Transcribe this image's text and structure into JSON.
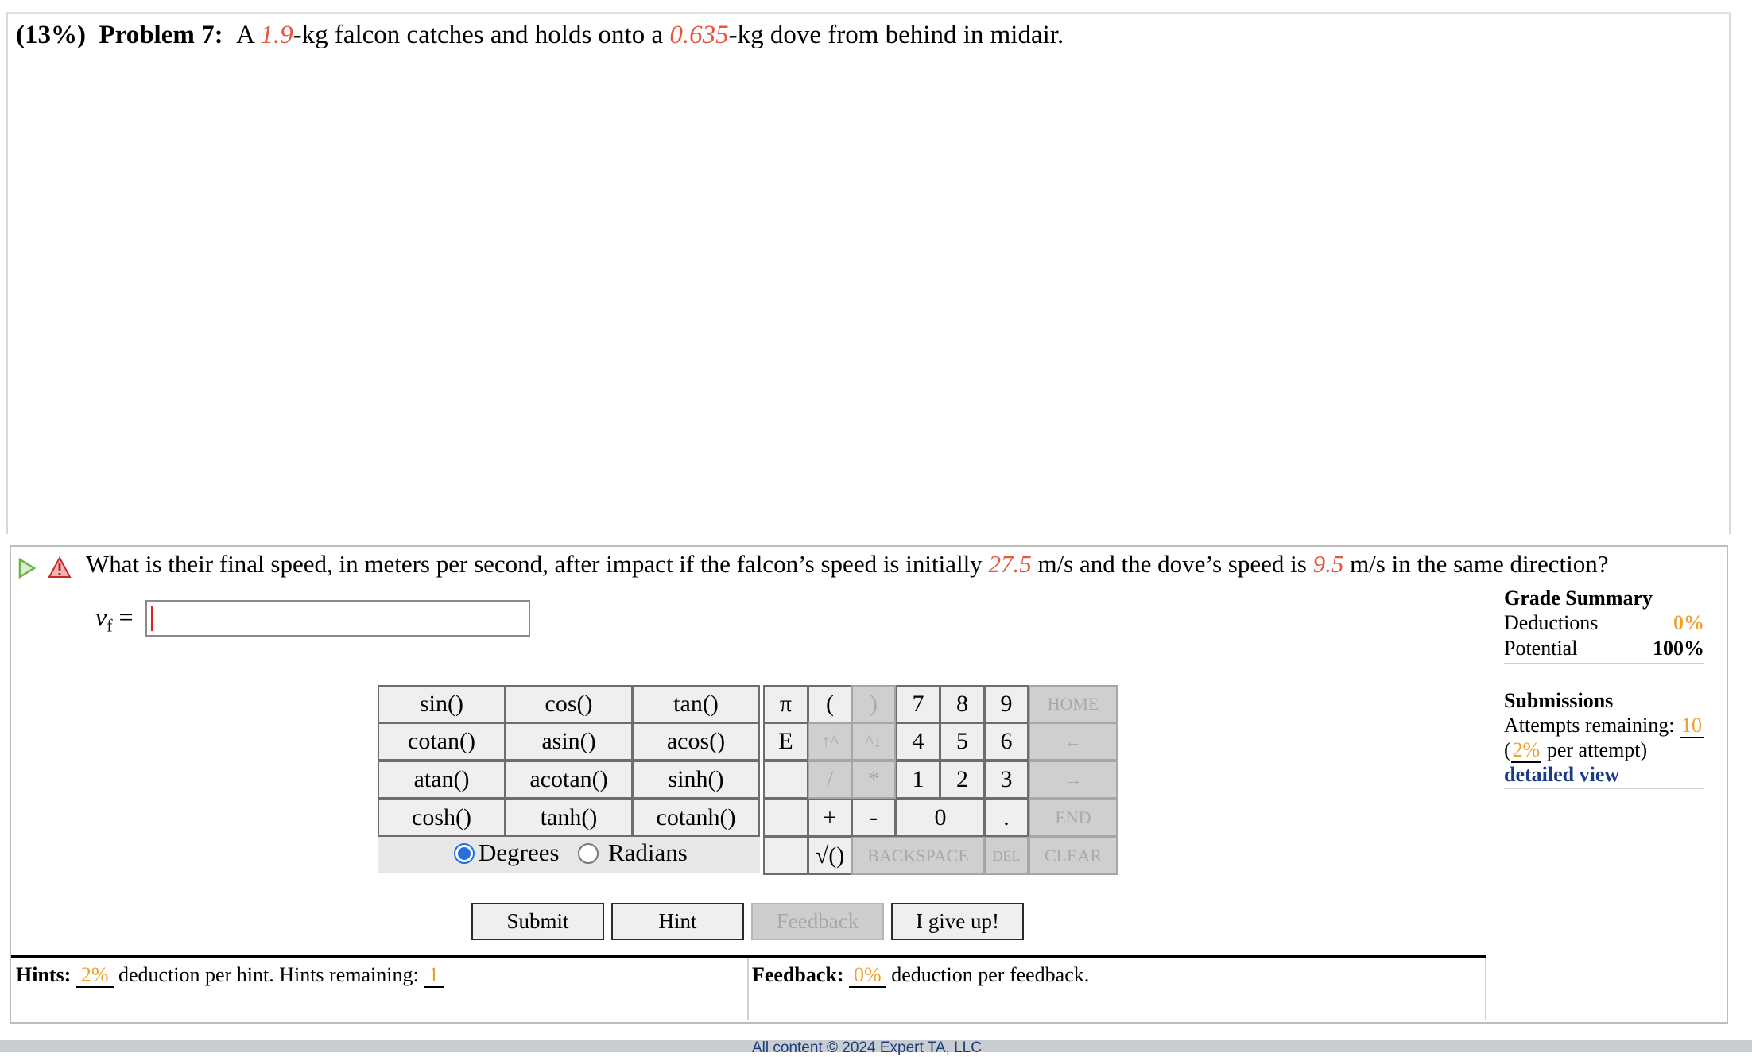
{
  "problem": {
    "weight": "(13%)",
    "label": "Problem 7:",
    "text_a": "A ",
    "mass_falcon": "1.9",
    "text_b": "-kg falcon catches and holds onto a ",
    "mass_dove": "0.635",
    "text_c": "-kg dove from behind in midair."
  },
  "question": {
    "text_a": "What is their final speed, in meters per second, after impact if the falcon’s speed is initially ",
    "v_falcon": "27.5",
    "text_b": " m/s and the dove’s speed is ",
    "v_dove": "9.5",
    "text_c": " m/s in the same direction?"
  },
  "answer": {
    "var": "v",
    "sub": "f",
    "eq": "=",
    "value": ""
  },
  "keypad": {
    "funcs": [
      [
        "sin()",
        "cos()",
        "tan()"
      ],
      [
        "cotan()",
        "asin()",
        "acos()"
      ],
      [
        "atan()",
        "acotan()",
        "sinh()"
      ],
      [
        "cosh()",
        "tanh()",
        "cotanh()"
      ]
    ],
    "pi": "π",
    "e": "E",
    "open_paren": "(",
    "close_paren": ")",
    "up_arrow": "↑^",
    "down_arrow": "^↓",
    "divide": "/",
    "multiply": "*",
    "plus": "+",
    "minus": "-",
    "sqrt": "√()",
    "digits": [
      "7",
      "8",
      "9",
      "4",
      "5",
      "6",
      "1",
      "2",
      "3"
    ],
    "zero": "0",
    "dot": ".",
    "home": "HOME",
    "left": "←",
    "right": "→",
    "end": "END",
    "backspace": "BACKSPACE",
    "del": "DEL",
    "clear": "CLEAR",
    "degrees": "Degrees",
    "radians": "Radians",
    "angle_mode": "Degrees"
  },
  "buttons": {
    "submit": "Submit",
    "hint": "Hint",
    "feedback": "Feedback",
    "give_up": "I give up!"
  },
  "hints": {
    "label": "Hints:",
    "deduction": "2%",
    "text": "deduction per hint. Hints remaining:",
    "remaining": "1"
  },
  "feedback": {
    "label": "Feedback:",
    "deduction": "0%",
    "text": "deduction per feedback."
  },
  "grade_summary": {
    "title": "Grade Summary",
    "deductions_label": "Deductions",
    "deductions_value": "0%",
    "potential_label": "Potential",
    "potential_value": "100%"
  },
  "submissions": {
    "title": "Submissions",
    "attempts_label": "Attempts remaining:",
    "attempts_value": "10",
    "per_attempt_open": "(",
    "per_attempt_pct": "2%",
    "per_attempt_text": " per attempt)",
    "detailed_link": "detailed view"
  },
  "footer": {
    "text": "All content © 2024 Expert TA, LLC"
  },
  "colors": {
    "given_value": "#e8563f",
    "percent_highlight": "#f0a030",
    "link": "#1a3a8a"
  }
}
